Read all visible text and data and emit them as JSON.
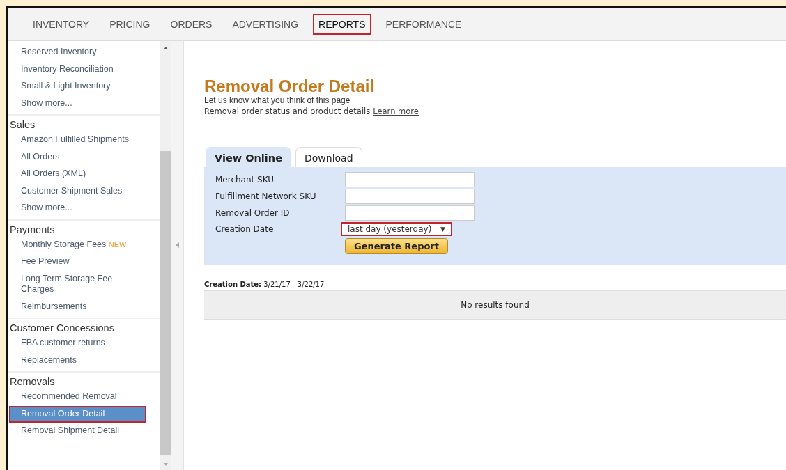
{
  "nav": [
    {
      "label": "INVENTORY",
      "selected": false,
      "highlighted": false
    },
    {
      "label": "PRICING",
      "selected": false,
      "highlighted": false
    },
    {
      "label": "ORDERS",
      "selected": false,
      "highlighted": false
    },
    {
      "label": "ADVERTISING",
      "selected": false,
      "highlighted": false
    },
    {
      "label": "REPORTS",
      "selected": true,
      "highlighted": true
    },
    {
      "label": "PERFORMANCE",
      "selected": false,
      "highlighted": false
    }
  ],
  "sidebar": {
    "groups": [
      {
        "items": [
          {
            "label": "Reserved Inventory",
            "selected": false,
            "highlighted": false
          },
          {
            "label": "Inventory Reconciliation",
            "selected": false,
            "highlighted": false
          },
          {
            "label": "Small & Light Inventory",
            "selected": false,
            "highlighted": false
          },
          {
            "label": "Show more...",
            "selected": false,
            "highlighted": false
          }
        ]
      },
      {
        "heading": "Sales",
        "items": [
          {
            "label": "Amazon Fulfilled Shipments",
            "selected": false,
            "highlighted": false
          },
          {
            "label": "All Orders",
            "selected": false,
            "highlighted": false
          },
          {
            "label": "All Orders (XML)",
            "selected": false,
            "highlighted": false
          },
          {
            "label": "Customer Shipment Sales",
            "selected": false,
            "highlighted": false
          },
          {
            "label": "Show more...",
            "selected": false,
            "highlighted": false
          }
        ]
      },
      {
        "heading": "Payments",
        "items": [
          {
            "label": "Monthly Storage Fees",
            "badge": "NEW",
            "selected": false,
            "highlighted": false
          },
          {
            "label": "Fee Preview",
            "selected": false,
            "highlighted": false
          },
          {
            "label": "Long Term Storage Fee Charges",
            "selected": false,
            "highlighted": false
          },
          {
            "label": "Reimbursements",
            "selected": false,
            "highlighted": false
          }
        ]
      },
      {
        "heading": "Customer Concessions",
        "items": [
          {
            "label": "FBA customer returns",
            "selected": false,
            "highlighted": false
          },
          {
            "label": "Replacements",
            "selected": false,
            "highlighted": false
          }
        ]
      },
      {
        "heading": "Removals",
        "items": [
          {
            "label": "Recommended Removal",
            "selected": false,
            "highlighted": false
          },
          {
            "label": "Removal Order Detail",
            "selected": true,
            "highlighted": true
          },
          {
            "label": "Removal Shipment Detail",
            "selected": false,
            "highlighted": false
          }
        ]
      }
    ]
  },
  "page": {
    "title": "Removal Order Detail",
    "feedback": "Let us know what you think of this page",
    "description": "Removal order status and product details",
    "link": "Learn more"
  },
  "tabs": [
    {
      "label": "View Online",
      "selected": true
    },
    {
      "label": "Download",
      "selected": false
    }
  ],
  "form": {
    "fields": [
      {
        "label": "Merchant SKU",
        "kind": "text",
        "highlighted": false
      },
      {
        "label": "Fulfillment Network SKU",
        "kind": "text",
        "highlighted": false
      },
      {
        "label": "Removal Order ID",
        "kind": "text",
        "highlighted": false
      },
      {
        "label": "Creation Date",
        "kind": "select",
        "value": "last day (yesterday)",
        "arrow": "▼",
        "highlighted": true
      }
    ],
    "button": "Generate Report"
  },
  "results": {
    "range": "**Creation Date:** 3/21/17 - 3/22/17",
    "message": "No results found"
  }
}
